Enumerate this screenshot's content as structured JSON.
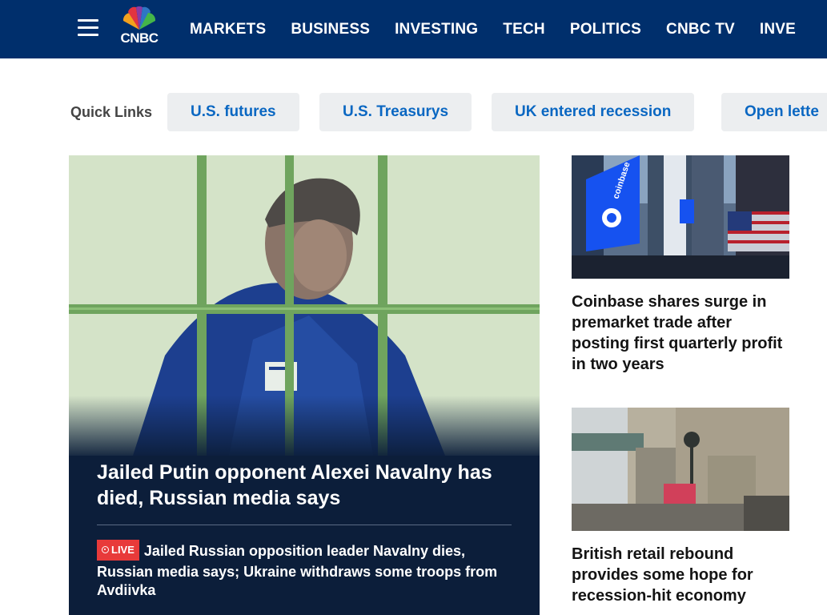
{
  "nav": {
    "logo_text": "CNBC",
    "items": [
      "MARKETS",
      "BUSINESS",
      "INVESTING",
      "TECH",
      "POLITICS",
      "CNBC TV",
      "INVE"
    ]
  },
  "quick_links": {
    "label": "Quick Links",
    "items": [
      "U.S. futures",
      "U.S. Treasurys",
      "UK entered recession",
      "Open lette"
    ]
  },
  "hero": {
    "title": "Jailed Putin opponent Alexei Navalny has died, Russian media says",
    "live_label": "LIVE",
    "subheadline": "Jailed Russian opposition leader Navalny dies, Russian media says; Ukraine withdraws some troops from Avdiivka"
  },
  "side_stories": [
    {
      "title": "Coinbase shares surge in premarket trade after posting first quarterly profit in two years",
      "image_sign_text": "coinbase"
    },
    {
      "title": "British retail rebound provides some hope for recession-hit economy"
    }
  ],
  "colors": {
    "nav_bg": "#002f6c",
    "link_blue": "#0a67c2",
    "hero_bg": "#0c1e3a",
    "live_red": "#e83a3a",
    "chip_bg": "#eceef0"
  }
}
